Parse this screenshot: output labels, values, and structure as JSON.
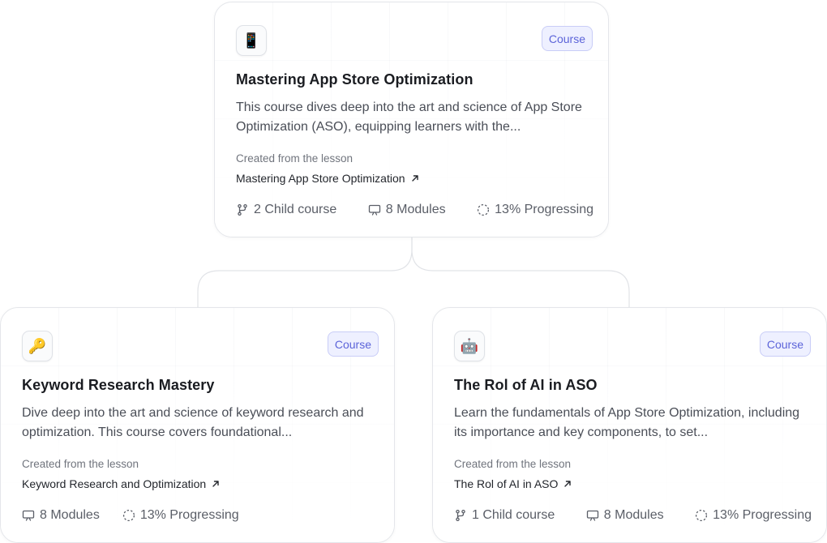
{
  "cards": [
    {
      "emoji": "📱",
      "emoji_icon": "mobile-phone-icon",
      "badge": "Course",
      "title": "Mastering App Store Optimization",
      "description": "This course dives deep into the art and science of App Store Optimization (ASO), equipping learners with the...",
      "created_label": "Created from the lesson",
      "lesson_link": "Mastering App Store Optimization",
      "child_courses": "2 Child course",
      "modules": "8 Modules",
      "progress": "13% Progressing"
    },
    {
      "emoji": "🔑",
      "emoji_icon": "key-icon",
      "badge": "Course",
      "title": "Keyword Research Mastery",
      "description": "Dive deep into the art and science of keyword research and optimization. This course covers foundational...",
      "created_label": "Created from the lesson",
      "lesson_link": "Keyword Research and Optimization",
      "modules": "8 Modules",
      "progress": "13% Progressing"
    },
    {
      "emoji": "🤖",
      "emoji_icon": "robot-icon",
      "badge": "Course",
      "title": "The Rol of AI in ASO",
      "description": "Learn the fundamentals of App Store Optimization, including its importance and key components, to set...",
      "created_label": "Created from the lesson",
      "lesson_link": "The Rol of AI in ASO",
      "child_courses": "1 Child course",
      "modules": "8 Modules",
      "progress": "13% Progressing"
    }
  ],
  "colors": {
    "badge_text": "#5c64d9",
    "badge_bg": "#eef0ff",
    "badge_border": "#c9cdf7",
    "card_border": "#e4e6ea",
    "connector": "#e1e3e7"
  }
}
